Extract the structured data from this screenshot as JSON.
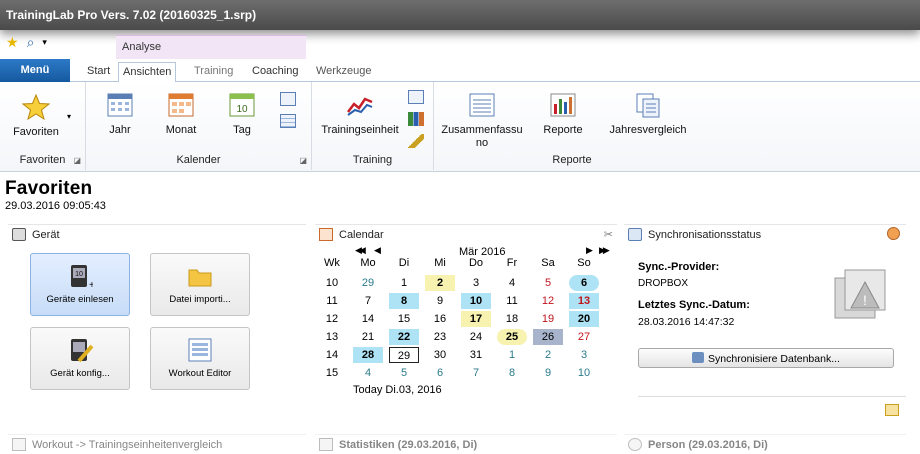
{
  "window": {
    "title": "TrainingLab Pro Vers. 7.02 (20160325_1.srp)"
  },
  "ribbon": {
    "context_tab": "Analyse",
    "menu": "Menü",
    "tabs": [
      "Start",
      "Ansichten",
      "Training",
      "Coaching",
      "Werkzeuge"
    ],
    "groups": {
      "favoriten": {
        "label": "Favoriten",
        "button": "Favoriten"
      },
      "kalender": {
        "label": "Kalender",
        "buttons": [
          "Jahr",
          "Monat",
          "Tag"
        ]
      },
      "training": {
        "label": "Training",
        "button": "Trainingseinheit"
      },
      "reporte": {
        "label": "Reporte",
        "buttons": [
          "Zusammenfassu\nno",
          "Reporte",
          "Jahresvergleich"
        ]
      }
    }
  },
  "page": {
    "title": "Favoriten",
    "datetime": "29.03.2016 09:05:43"
  },
  "geraet": {
    "header": "Gerät",
    "tiles": [
      "Geräte einlesen",
      "Datei importi...",
      "Gerät konfig...",
      "Workout Editor"
    ]
  },
  "calendar": {
    "header": "Calendar",
    "month": "Mär 2016",
    "nav": {
      "first": "◀◀",
      "prev": "◀",
      "next": "▶",
      "last": "▶▶"
    },
    "weekday_headers": [
      "Wk",
      "Mo",
      "Di",
      "Mi",
      "Do",
      "Fr",
      "Sa",
      "So"
    ],
    "weeks": [
      {
        "wk": "10",
        "days": [
          "29",
          "1",
          "2",
          "3",
          "4",
          "5",
          "6"
        ]
      },
      {
        "wk": "11",
        "days": [
          "7",
          "8",
          "9",
          "10",
          "11",
          "12",
          "13"
        ]
      },
      {
        "wk": "12",
        "days": [
          "14",
          "15",
          "16",
          "17",
          "18",
          "19",
          "20"
        ]
      },
      {
        "wk": "13",
        "days": [
          "21",
          "22",
          "23",
          "24",
          "25",
          "26",
          "27"
        ]
      },
      {
        "wk": "14",
        "days": [
          "28",
          "29",
          "30",
          "31",
          "1",
          "2",
          "3"
        ]
      },
      {
        "wk": "15",
        "days": [
          "4",
          "5",
          "6",
          "7",
          "8",
          "9",
          "10"
        ]
      }
    ],
    "today_text": "Today Di.03, 2016"
  },
  "sync": {
    "header": "Synchronisationsstatus",
    "provider_label": "Sync.-Provider:",
    "provider_value": "DROPBOX",
    "last_label": "Letztes Sync.-Datum:",
    "last_value": "28.03.2016 14:47:32",
    "button": "Synchronisiere Datenbank..."
  },
  "bottom_panels": [
    "Workout -> Trainingseinheitenvergleich",
    "Statistiken (29.03.2016, Di)",
    "Person (29.03.2016, Di)"
  ],
  "colors": {
    "accent": "#1e6fc0",
    "highlight_blue": "#aee3f5",
    "highlight_yellow": "#f7f2b0",
    "weekend_red": "#c0141c"
  }
}
